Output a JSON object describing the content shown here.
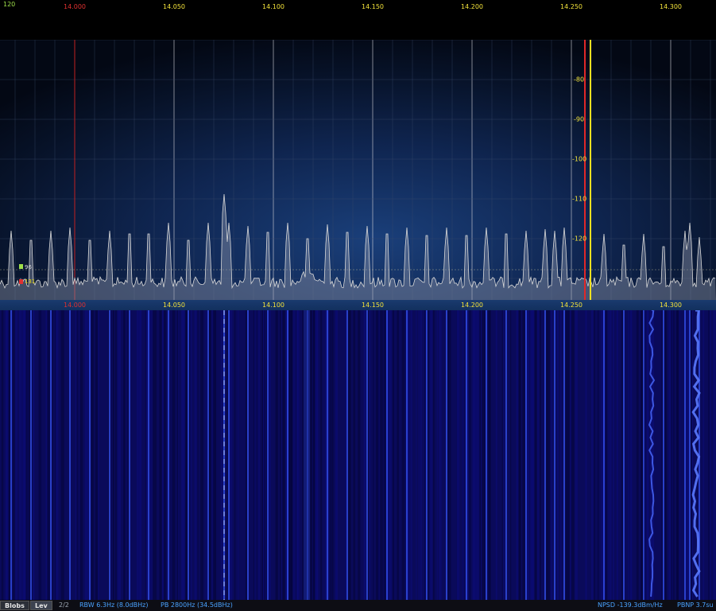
{
  "spectrum_view": {
    "corner_level": "120",
    "frequency_ticks": [
      "14.000",
      "14.050",
      "14.100",
      "14.150",
      "14.200",
      "14.250",
      "14.300"
    ],
    "red_frequency": "14.000",
    "level_ticks": [
      "-80",
      "-90",
      "-100",
      "-110",
      "-120"
    ],
    "markers": {
      "upper_label": "96",
      "lower_label": "131",
      "upper_color": "#9fe04a",
      "lower_color": "#e03030"
    },
    "colors": {
      "trace": "#d8d8d8",
      "grid": "#3a4a6a",
      "tuning_marker_red": "#e02828",
      "tuning_marker_yellow": "#f0e020",
      "axis_label": "#f2e23a",
      "waterfall_bg": "#0a0a5a",
      "waterfall_line": "#3a5aff"
    }
  },
  "statusbar": {
    "blobs_button": "Blobs",
    "lev_button": "Lev",
    "page_indicator": "2/2",
    "rbw": "RBW 6.3Hz (8.0dBHz)",
    "passband": "PB 2800Hz (34.5dBHz)",
    "npsd": "NPSD -139.3dBm/Hz",
    "pbnp": "PBNP 3.7su"
  }
}
